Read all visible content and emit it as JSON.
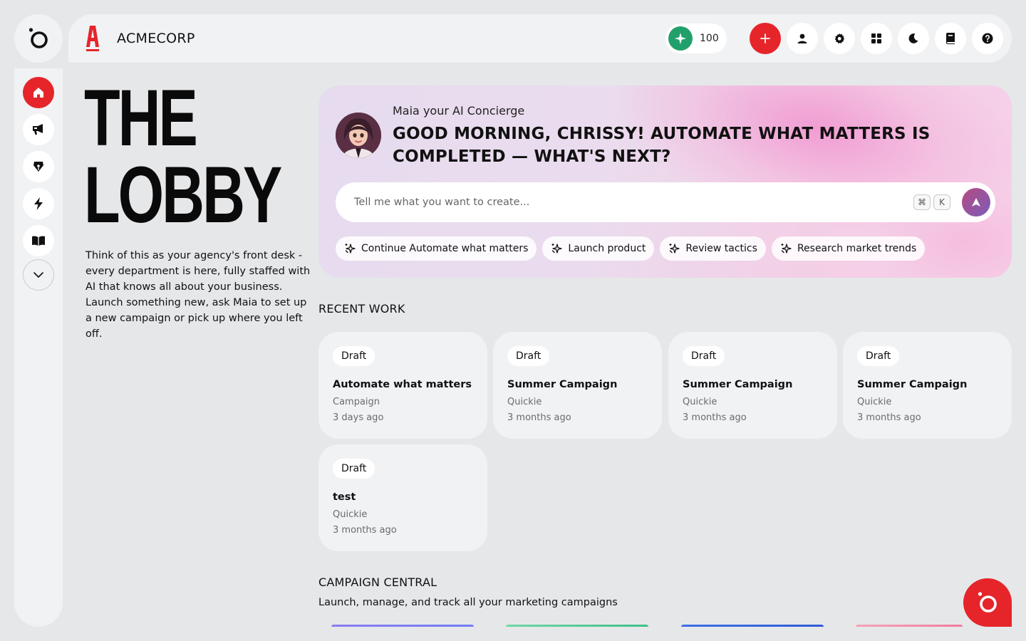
{
  "brand": {
    "name": "ACMECORP",
    "mark_letter": "A",
    "mark_color": "#e5252a"
  },
  "header": {
    "credits": "100",
    "buttons": [
      "plus-icon",
      "user-icon",
      "gear-icon",
      "grid-icon",
      "moon-icon",
      "book-icon",
      "help-icon"
    ]
  },
  "sidebar": {
    "items": [
      "home-icon",
      "megaphone-icon",
      "pen-icon",
      "bolt-icon",
      "book-open-icon",
      "chevron-down-icon"
    ]
  },
  "hero": {
    "title_line1": "THE",
    "title_line2": "LOBBY",
    "description": "Think of this as your agency's front desk - every department is here, fully staffed with AI that knows all about your business. Launch something new, ask Maia to set up a new campaign or pick up where you left off."
  },
  "concierge": {
    "label": "Maia your AI Concierge",
    "headline": "GOOD MORNING, CHRISSY! AUTOMATE WHAT MATTERS IS COMPLETED — WHAT'S NEXT?",
    "input_placeholder": "Tell me what you want to create...",
    "shortcut_mod": "⌘",
    "shortcut_key": "K",
    "chips": [
      "Continue Automate what matters",
      "Launch product",
      "Review tactics",
      "Research market trends"
    ]
  },
  "recent_work": {
    "title": "RECENT WORK",
    "items": [
      {
        "status": "Draft",
        "title": "Automate what matters",
        "type": "Campaign",
        "time": "3 days ago"
      },
      {
        "status": "Draft",
        "title": "Summer Campaign",
        "type": "Quickie",
        "time": "3 months ago"
      },
      {
        "status": "Draft",
        "title": "Summer Campaign",
        "type": "Quickie",
        "time": "3 months ago"
      },
      {
        "status": "Draft",
        "title": "Summer Campaign",
        "type": "Quickie",
        "time": "3 months ago"
      },
      {
        "status": "Draft",
        "title": "test",
        "type": "Quickie",
        "time": "3 months ago"
      }
    ]
  },
  "campaign_central": {
    "title": "CAMPAIGN CENTRAL",
    "subtitle": "Launch, manage, and track all your marketing campaigns"
  },
  "colors": {
    "accent": "#e5252a",
    "credits": "#22a06b",
    "background": "#e6e7e9",
    "panel": "#f1f2f4"
  }
}
